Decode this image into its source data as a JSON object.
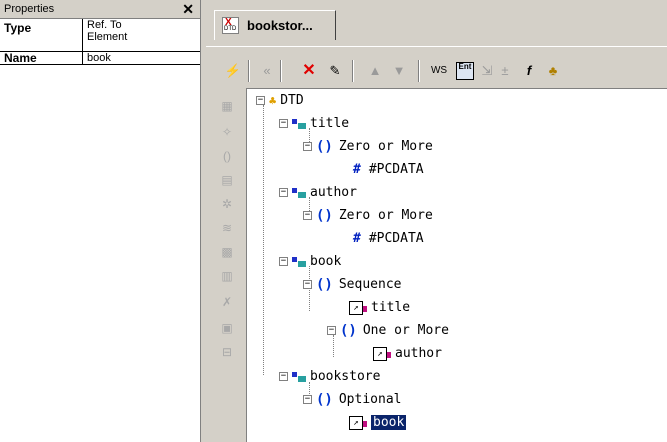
{
  "properties": {
    "title": "Properties",
    "close_glyph": "✕",
    "rows": [
      {
        "key": "Type",
        "value_line1": "Ref. To",
        "value_line2": "Element"
      },
      {
        "key": "Name",
        "value": "book"
      }
    ]
  },
  "tab": {
    "label": "bookstor...",
    "badge_top": "X",
    "badge_bottom": "DTD"
  },
  "toolbar": {
    "buttons": [
      {
        "name": "validate",
        "icon": "lightning-icon"
      },
      {
        "name": "back",
        "icon": "back-arrow-icon"
      },
      {
        "name": "delete",
        "icon": "delete-x-icon"
      },
      {
        "name": "edit",
        "icon": "edit-pencil-icon"
      },
      {
        "name": "move-up",
        "icon": "arrow-up-icon"
      },
      {
        "name": "move-down",
        "icon": "arrow-down-icon"
      },
      {
        "name": "whitespace",
        "label": "WS"
      },
      {
        "name": "entities",
        "label": "Ent"
      },
      {
        "name": "expand",
        "icon": "expand-icon"
      },
      {
        "name": "function",
        "icon": "function-icon"
      },
      {
        "name": "hierarchy",
        "icon": "hierarchy-icon"
      }
    ]
  },
  "tree": {
    "nodes": [
      {
        "label": "DTD"
      },
      {
        "label": "title"
      },
      {
        "label": "Zero or More"
      },
      {
        "label": "#PCDATA"
      },
      {
        "label": "author"
      },
      {
        "label": "Zero or More"
      },
      {
        "label": "#PCDATA"
      },
      {
        "label": "book"
      },
      {
        "label": "Sequence"
      },
      {
        "label": "title"
      },
      {
        "label": "One or More"
      },
      {
        "label": "author"
      },
      {
        "label": "bookstore"
      },
      {
        "label": "Optional"
      },
      {
        "label": "book",
        "selected": true
      }
    ]
  },
  "colors": {
    "selection": "#0a246a",
    "element_blue": "#2030c8",
    "element_teal": "#28a0a0",
    "delete_red": "#e00000"
  }
}
